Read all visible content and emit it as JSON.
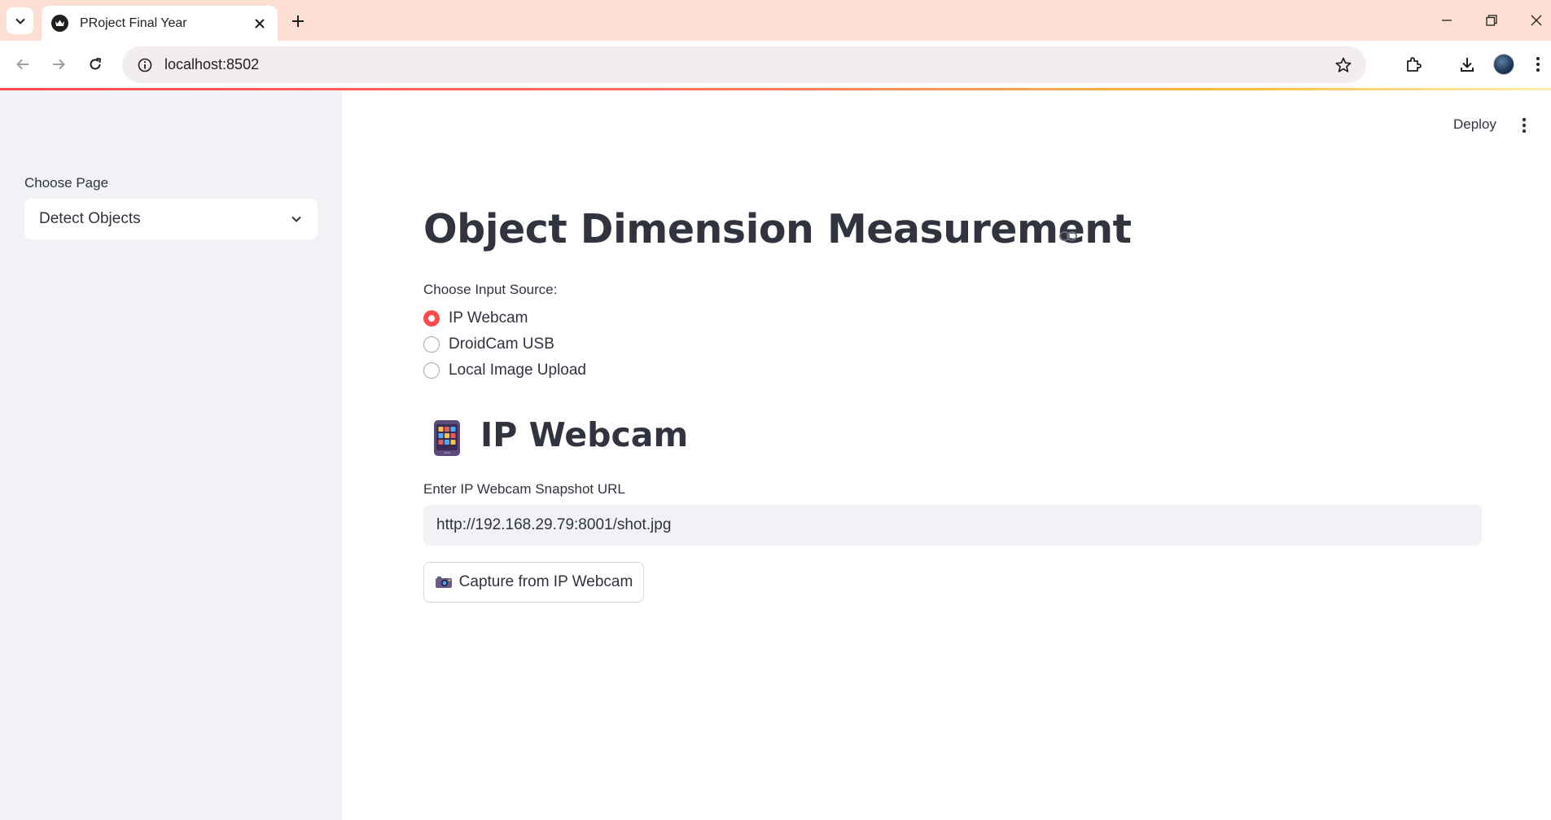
{
  "browser": {
    "tab_title": "PRoject Final Year",
    "url": "localhost:8502"
  },
  "colors": {
    "accent": "#ff4b4b",
    "titlebar": "#fde0d3",
    "sidebar_bg": "#f0f2f6",
    "text": "#31333f"
  },
  "header": {
    "deploy_label": "Deploy"
  },
  "sidebar": {
    "select_label": "Choose Page",
    "select_value": "Detect Objects"
  },
  "main": {
    "title": "Object Dimension Measurement",
    "radio_group": {
      "label": "Choose Input Source:",
      "options": [
        {
          "label": "IP Webcam",
          "selected": true
        },
        {
          "label": "DroidCam USB",
          "selected": false
        },
        {
          "label": "Local Image Upload",
          "selected": false
        }
      ]
    },
    "section": {
      "icon": "mobile-phone-icon",
      "title": "IP Webcam"
    },
    "url_input": {
      "label": "Enter IP Webcam Snapshot URL",
      "value": "http://192.168.29.79:8001/shot.jpg"
    },
    "capture_button": {
      "icon": "camera-icon",
      "label": "Capture from IP Webcam"
    }
  }
}
